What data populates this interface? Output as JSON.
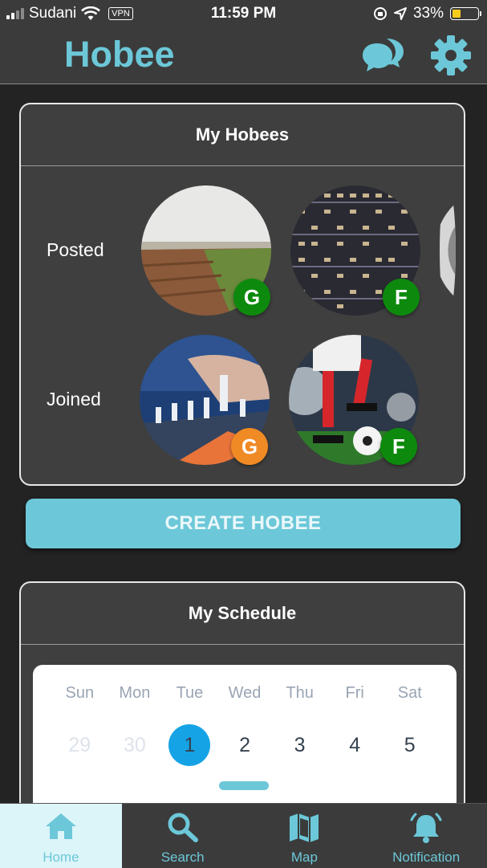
{
  "status_bar": {
    "carrier": "Sudani",
    "vpn": "VPN",
    "time": "11:59 PM",
    "battery": "33%"
  },
  "header": {
    "title": "Hobee",
    "icons": [
      "chat-icon",
      "gear-icon"
    ],
    "accent": "#6cc8d8"
  },
  "my_hobees": {
    "title": "My Hobees",
    "posted_label": "Posted",
    "joined_label": "Joined",
    "posted": [
      {
        "badge": "G"
      },
      {
        "badge": "F"
      }
    ],
    "joined": [
      {
        "badge": "G"
      },
      {
        "badge": "F"
      }
    ]
  },
  "create_button": "CREATE HOBEE",
  "schedule": {
    "title": "My Schedule",
    "weekdays": [
      "Sun",
      "Mon",
      "Tue",
      "Wed",
      "Thu",
      "Fri",
      "Sat"
    ],
    "dates": [
      "29",
      "30",
      "1",
      "2",
      "3",
      "4",
      "5"
    ]
  },
  "tabs": [
    {
      "label": "Home",
      "icon": "home-icon"
    },
    {
      "label": "Search",
      "icon": "search-icon"
    },
    {
      "label": "Map",
      "icon": "map-icon"
    },
    {
      "label": "Notification",
      "icon": "bell-icon"
    }
  ]
}
